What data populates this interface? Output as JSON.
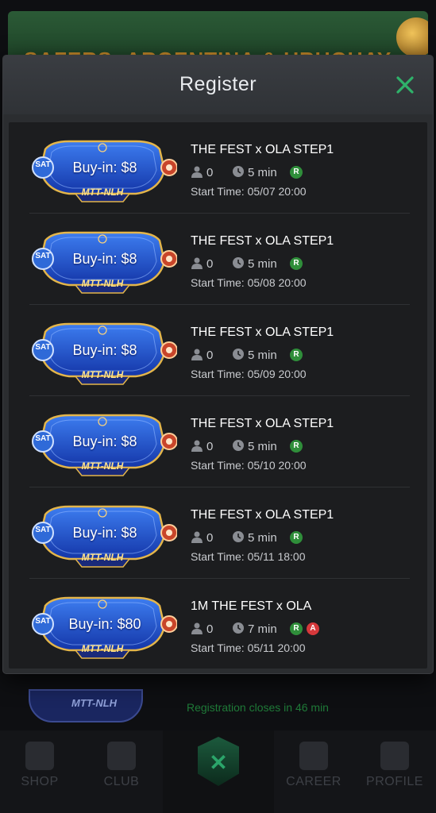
{
  "background": {
    "banner_text": "SAFERS: ARGENTINA & URUGUAY",
    "ticket_label": "MTT-NLH",
    "registration_note": "Registration closes in 46 min",
    "nav": [
      {
        "label": "SHOP",
        "icon": "shop-bag-icon"
      },
      {
        "label": "CLUB",
        "icon": "club-shield-icon"
      },
      {
        "label": "",
        "icon": "home-logo-icon"
      },
      {
        "label": "CAREER",
        "icon": "career-chart-icon"
      },
      {
        "label": "PROFILE",
        "icon": "profile-person-icon"
      }
    ]
  },
  "modal": {
    "title": "Register",
    "close_icon": "close-x-icon",
    "accent": "#2fb26a"
  },
  "tournaments": [
    {
      "sat": "SAT",
      "buyin": "Buy-in: $8",
      "game": "MTT-NLH",
      "name": "THE FEST x OLA STEP1",
      "players": "0",
      "duration": "5 min",
      "badges": [
        "R"
      ],
      "start": "Start Time: 05/07 20:00"
    },
    {
      "sat": "SAT",
      "buyin": "Buy-in: $8",
      "game": "MTT-NLH",
      "name": "THE FEST x OLA STEP1",
      "players": "0",
      "duration": "5 min",
      "badges": [
        "R"
      ],
      "start": "Start Time: 05/08 20:00"
    },
    {
      "sat": "SAT",
      "buyin": "Buy-in: $8",
      "game": "MTT-NLH",
      "name": "THE FEST x OLA STEP1",
      "players": "0",
      "duration": "5 min",
      "badges": [
        "R"
      ],
      "start": "Start Time: 05/09 20:00"
    },
    {
      "sat": "SAT",
      "buyin": "Buy-in: $8",
      "game": "MTT-NLH",
      "name": "THE FEST x OLA STEP1",
      "players": "0",
      "duration": "5 min",
      "badges": [
        "R"
      ],
      "start": "Start Time: 05/10 20:00"
    },
    {
      "sat": "SAT",
      "buyin": "Buy-in: $8",
      "game": "MTT-NLH",
      "name": "THE FEST x OLA STEP1",
      "players": "0",
      "duration": "5 min",
      "badges": [
        "R"
      ],
      "start": "Start Time: 05/11 18:00"
    },
    {
      "sat": "SAT",
      "buyin": "Buy-in: $80",
      "game": "MTT-NLH",
      "name": "1M THE FEST x OLA",
      "players": "0",
      "duration": "7 min",
      "badges": [
        "R",
        "A"
      ],
      "start": "Start Time: 05/11 20:00"
    }
  ],
  "colors": {
    "badge_r": "#2f8e3a",
    "badge_a": "#d6383b",
    "ticket_blue": "#1f4fd0",
    "ticket_gold": "#e3b54a"
  }
}
